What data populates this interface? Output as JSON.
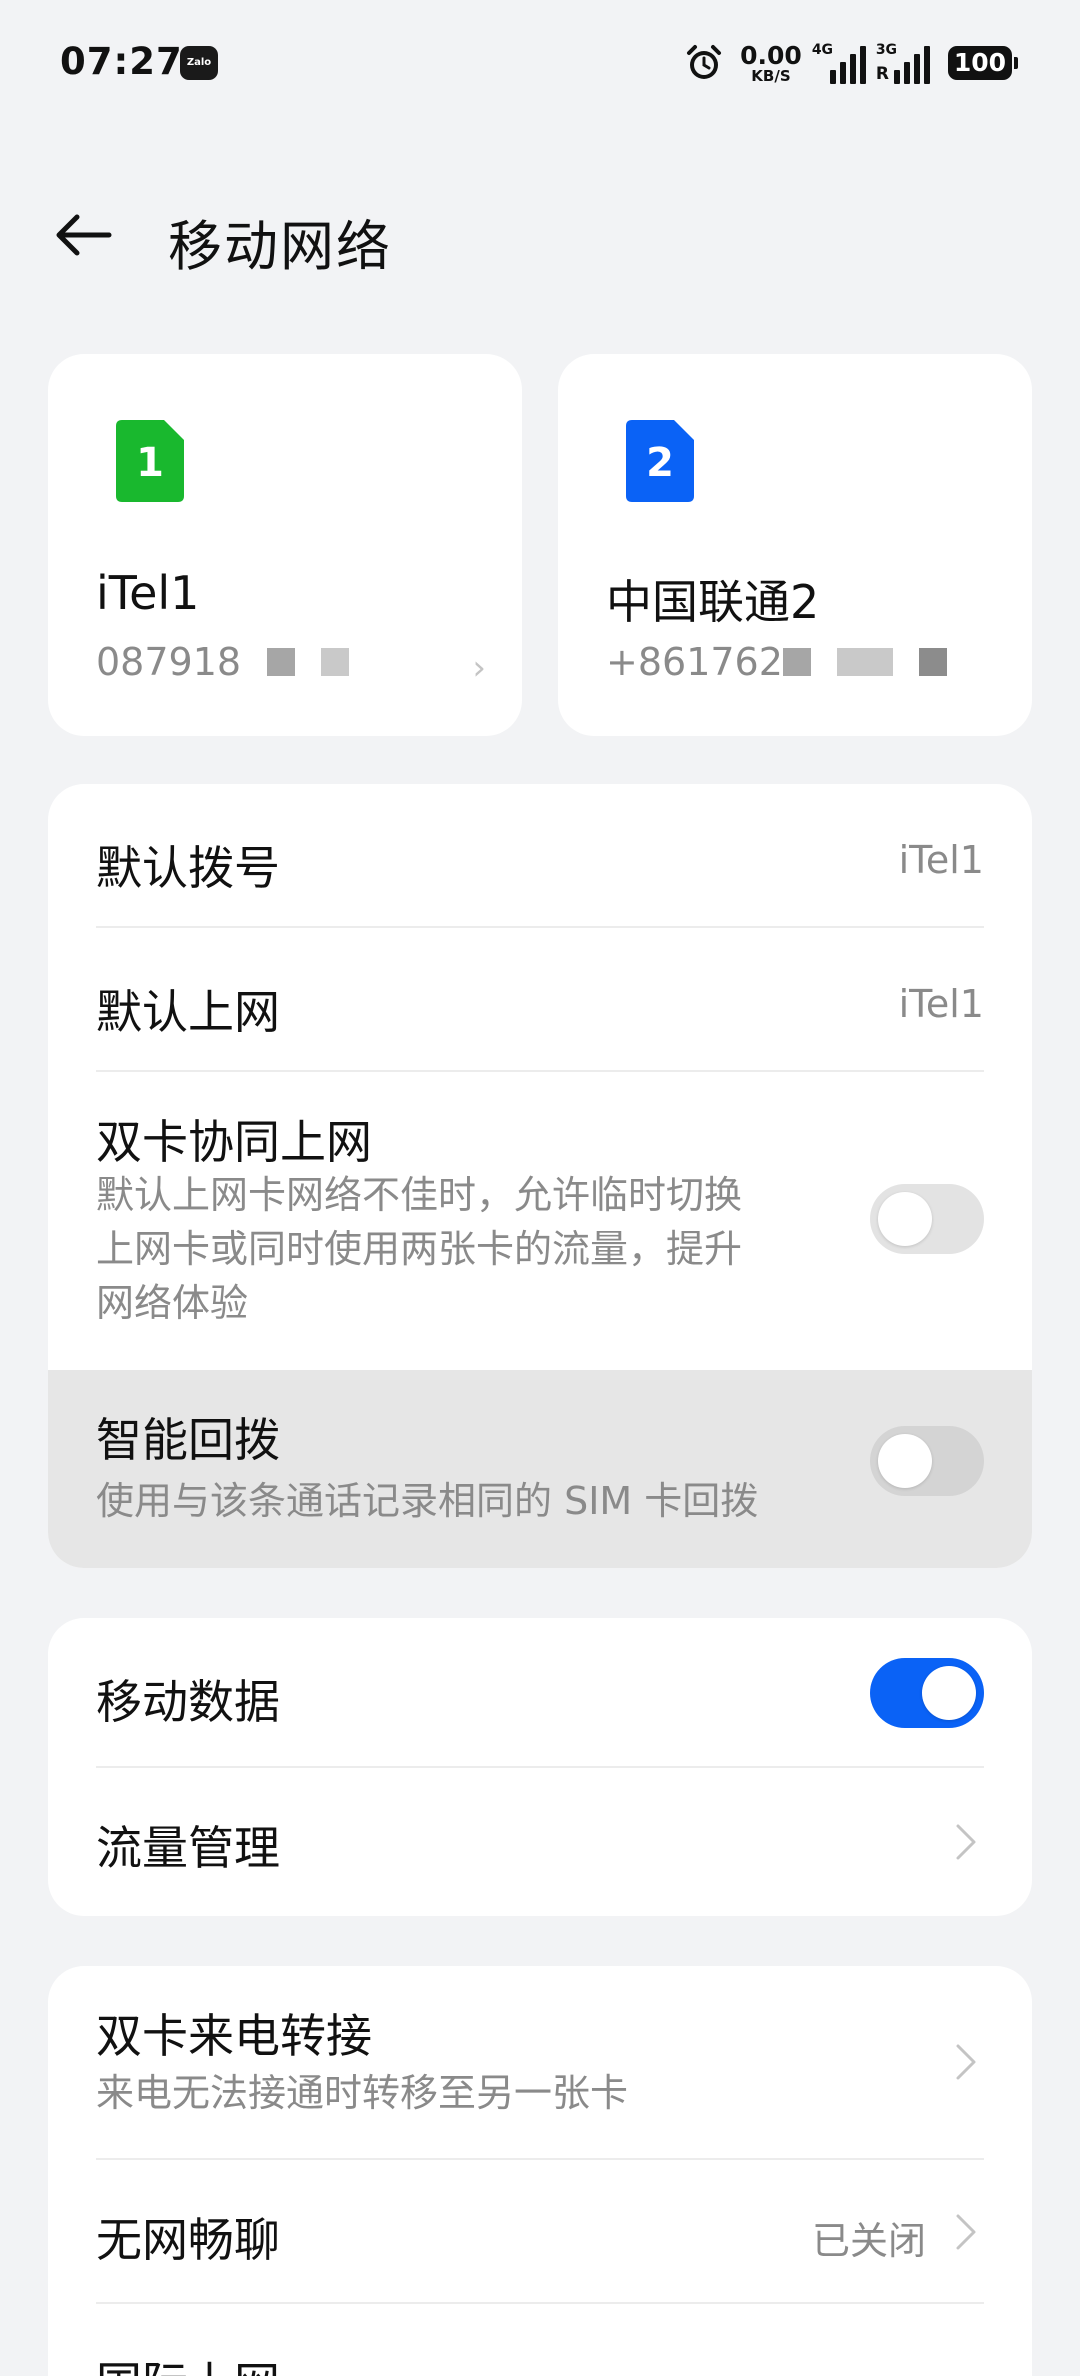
{
  "status_bar": {
    "time": "07:27",
    "zalo_label": "Zalo",
    "net_speed_value": "0.00",
    "net_speed_unit": "KB/S",
    "sim1_network": "4G",
    "sim2_network": "3G",
    "sim2_roaming": "R",
    "battery": "100",
    "icons": [
      "zalo-icon",
      "alarm-icon",
      "signal-icon",
      "battery-icon"
    ]
  },
  "header": {
    "title": "移动网络",
    "back_icon": "arrow-left-icon"
  },
  "sim_cards": [
    {
      "slot": "1",
      "name": "iTel1",
      "number": "087918",
      "color": "#19b82e"
    },
    {
      "slot": "2",
      "name": "中国联通2",
      "number": "+861762",
      "color": "#0a62f6"
    }
  ],
  "group1": {
    "default_dial": {
      "label": "默认拨号",
      "value": "iTel1"
    },
    "default_data": {
      "label": "默认上网",
      "value": "iTel1"
    },
    "dual_sim_data": {
      "label": "双卡协同上网",
      "desc_lines": [
        "默认上网卡网络不佳时，允许临时切换",
        "上网卡或同时使用两张卡的流量，提升",
        "网络体验"
      ],
      "enabled": false
    },
    "smart_callback": {
      "label": "智能回拨",
      "desc": "使用与该条通话记录相同的 SIM 卡回拨",
      "enabled": false
    }
  },
  "group2": {
    "mobile_data": {
      "label": "移动数据",
      "enabled": true
    },
    "data_usage": {
      "label": "流量管理"
    }
  },
  "group3": {
    "call_forward": {
      "label": "双卡来电转接",
      "desc": "来电无法接通时转移至另一张卡"
    },
    "wifi_calling": {
      "label": "无网畅聊",
      "value": "已关闭"
    },
    "intl_roaming": {
      "label": "国际上网"
    }
  },
  "colors": {
    "accent": "#0a62f6",
    "sim1": "#19b82e",
    "sim2": "#0a62f6",
    "background": "#f2f3f5"
  }
}
